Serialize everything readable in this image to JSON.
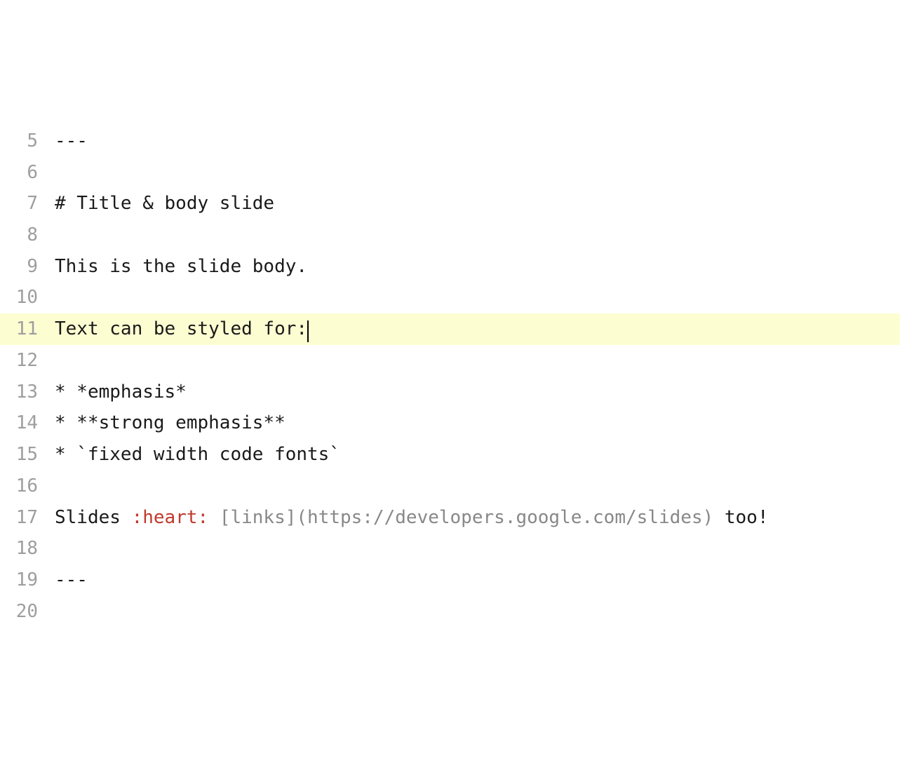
{
  "editor": {
    "activeLine": 11,
    "lines": [
      {
        "num": 5,
        "segments": [
          {
            "text": "---"
          }
        ]
      },
      {
        "num": 6,
        "segments": []
      },
      {
        "num": 7,
        "segments": [
          {
            "text": "# Title & body slide"
          }
        ]
      },
      {
        "num": 8,
        "segments": []
      },
      {
        "num": 9,
        "segments": [
          {
            "text": "This is the slide body."
          }
        ]
      },
      {
        "num": 10,
        "segments": []
      },
      {
        "num": 11,
        "segments": [
          {
            "text": "Text can be styled for:"
          }
        ],
        "cursor": true
      },
      {
        "num": 12,
        "segments": []
      },
      {
        "num": 13,
        "segments": [
          {
            "text": "* *emphasis*"
          }
        ]
      },
      {
        "num": 14,
        "segments": [
          {
            "text": "* **strong emphasis**"
          }
        ]
      },
      {
        "num": 15,
        "segments": [
          {
            "text": "* `fixed width code fonts`"
          }
        ]
      },
      {
        "num": 16,
        "segments": []
      },
      {
        "num": 17,
        "segments": [
          {
            "text": "Slides "
          },
          {
            "text": ":heart:",
            "class": "emoji"
          },
          {
            "text": " "
          },
          {
            "text": "[links](https://developers.google.com/slides)",
            "class": "link"
          },
          {
            "text": " too!"
          }
        ]
      },
      {
        "num": 18,
        "segments": []
      },
      {
        "num": 19,
        "segments": [
          {
            "text": "---"
          }
        ]
      },
      {
        "num": 20,
        "segments": []
      }
    ]
  }
}
